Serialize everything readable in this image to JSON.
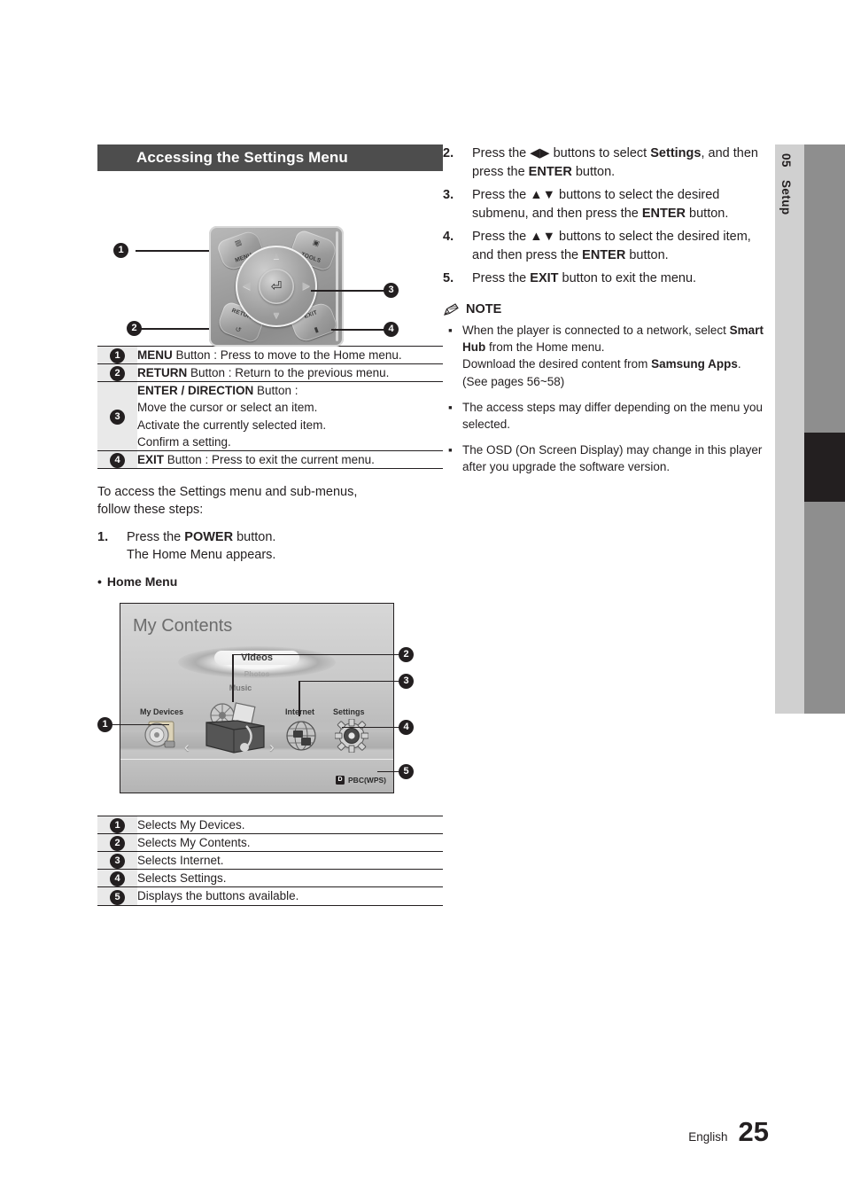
{
  "side_tab": {
    "number": "05",
    "name": "Setup"
  },
  "section": {
    "title": "Accessing the Settings Menu"
  },
  "remote": {
    "buttons": [
      {
        "label": "MENU",
        "glyph": "▥"
      },
      {
        "label": "TOOLS",
        "glyph": "▣"
      },
      {
        "label": "RETURN",
        "glyph": "↺"
      },
      {
        "label": "EXIT",
        "glyph": "▮"
      }
    ],
    "dpad": {
      "center_glyph": "⏎",
      "up": "▲",
      "down": "▼",
      "left": "◀",
      "right": "▶"
    },
    "callouts": [
      "1",
      "2",
      "3",
      "4"
    ]
  },
  "remote_table": [
    {
      "n": "1",
      "bold": "MENU",
      "rest": " Button : Press to move to the Home menu.",
      "extra": []
    },
    {
      "n": "2",
      "bold": "RETURN",
      "rest": " Button : Return to the previous menu.",
      "extra": []
    },
    {
      "n": "3",
      "bold": "ENTER / DIRECTION",
      "rest": " Button :",
      "extra": [
        "Move the cursor or select an item.",
        "Activate the currently selected item.",
        "Confirm a setting."
      ]
    },
    {
      "n": "4",
      "bold": "EXIT",
      "rest": " Button : Press to exit the current menu.",
      "extra": []
    }
  ],
  "intro": {
    "paragraph": "To access the Settings menu and sub-menus, follow these steps:",
    "step1_no": "1.",
    "step1_pre": "Press the ",
    "step1_bold": "POWER",
    "step1_post": " button.",
    "step1_line2": "The Home Menu appears.",
    "bullet": "Home Menu"
  },
  "home_menu": {
    "title": "My Contents",
    "carousel": {
      "selected": "Videos",
      "second": "Photos",
      "third": "Music"
    },
    "items": [
      {
        "label": "My Devices",
        "icon": "disc-icon"
      },
      {
        "label": "Internet",
        "icon": "globe-icon"
      },
      {
        "label": "Settings",
        "icon": "gear-icon"
      }
    ],
    "pbc_key": "D",
    "pbc_label": "PBC(WPS)",
    "chevron_left": "‹",
    "chevron_right": "›",
    "callouts": [
      "1",
      "2",
      "3",
      "4",
      "5"
    ]
  },
  "home_menu_table": [
    {
      "n": "1",
      "text": "Selects My Devices."
    },
    {
      "n": "2",
      "text": "Selects My Contents."
    },
    {
      "n": "3",
      "text": "Selects Internet."
    },
    {
      "n": "4",
      "text": "Selects Settings."
    },
    {
      "n": "5",
      "text": "Displays the buttons available."
    }
  ],
  "steps_right": [
    {
      "n": "2.",
      "parts": [
        {
          "t": "Press the ",
          "b": false
        },
        {
          "t": "◀▶",
          "b": false
        },
        {
          "t": " buttons to select ",
          "b": false
        },
        {
          "t": "Settings",
          "b": true
        },
        {
          "t": ", and then press the ",
          "b": false
        },
        {
          "t": "ENTER",
          "b": true
        },
        {
          "t": " button.",
          "b": false
        }
      ]
    },
    {
      "n": "3.",
      "parts": [
        {
          "t": "Press the ",
          "b": false
        },
        {
          "t": "▲▼",
          "b": false
        },
        {
          "t": " buttons to select the desired submenu, and then press the ",
          "b": false
        },
        {
          "t": "ENTER",
          "b": true
        },
        {
          "t": " button.",
          "b": false
        }
      ]
    },
    {
      "n": "4.",
      "parts": [
        {
          "t": "Press the ",
          "b": false
        },
        {
          "t": "▲▼",
          "b": false
        },
        {
          "t": " buttons to select the desired item, and then press the ",
          "b": false
        },
        {
          "t": "ENTER",
          "b": true
        },
        {
          "t": " button.",
          "b": false
        }
      ]
    },
    {
      "n": "5.",
      "parts": [
        {
          "t": "Press the ",
          "b": false
        },
        {
          "t": "EXIT",
          "b": true
        },
        {
          "t": " button to exit the menu.",
          "b": false
        }
      ]
    }
  ],
  "note": {
    "icon": "pencil-icon",
    "heading": "NOTE",
    "bullet_glyph": "▪",
    "items": [
      [
        {
          "t": "When the player is connected to a network, select ",
          "b": false
        },
        {
          "t": "Smart Hub",
          "b": true
        },
        {
          "t": " from the Home menu.",
          "b": false
        },
        {
          "t": "\nDownload the desired content from ",
          "b": false
        },
        {
          "t": "Samsung Apps",
          "b": true
        },
        {
          "t": ".\n(See pages 56~58)",
          "b": false
        }
      ],
      [
        {
          "t": "The access steps may differ depending on the menu you selected.",
          "b": false
        }
      ],
      [
        {
          "t": "The OSD (On Screen Display) may change in this player after you upgrade the software version.",
          "b": false
        }
      ]
    ]
  },
  "footer": {
    "language": "English",
    "page": "25"
  },
  "colors": {
    "header_bar": "#4d4d4d",
    "table_num_bg": "#e9e9e9",
    "ink": "#231f20",
    "tab_light": "#d0d0d0",
    "tab_dark": "#8e8e8e"
  }
}
